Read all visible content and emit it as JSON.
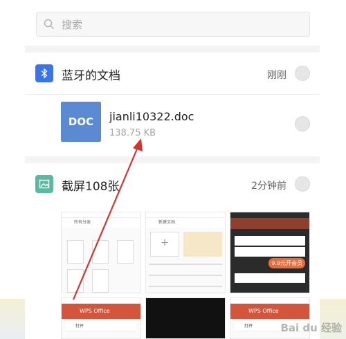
{
  "search": {
    "placeholder": "搜索"
  },
  "groups": [
    {
      "title": "蓝牙的文档",
      "time": "刚刚",
      "icon": "bluetooth-icon",
      "file": {
        "thumb_label": "DOC",
        "name": "jianli10322.doc",
        "size": "138.75 KB"
      }
    },
    {
      "title": "截屏108张",
      "time": "2分钟前",
      "icon": "image-icon"
    }
  ],
  "thumbs": {
    "t1_header": "所有分类",
    "t2_header": "新建文档",
    "t4_header": "WPS Office",
    "t6_header": "WPS Office",
    "t3_vip": "9.9元开会员",
    "t4_row": "打开",
    "t6_row": "打开"
  },
  "watermark": "Bai du 经验",
  "colors": {
    "bluetooth": "#3b74e8",
    "doc": "#5b8ad3",
    "screenshot": "#5ab9a0",
    "arrow": "#d0352f"
  }
}
